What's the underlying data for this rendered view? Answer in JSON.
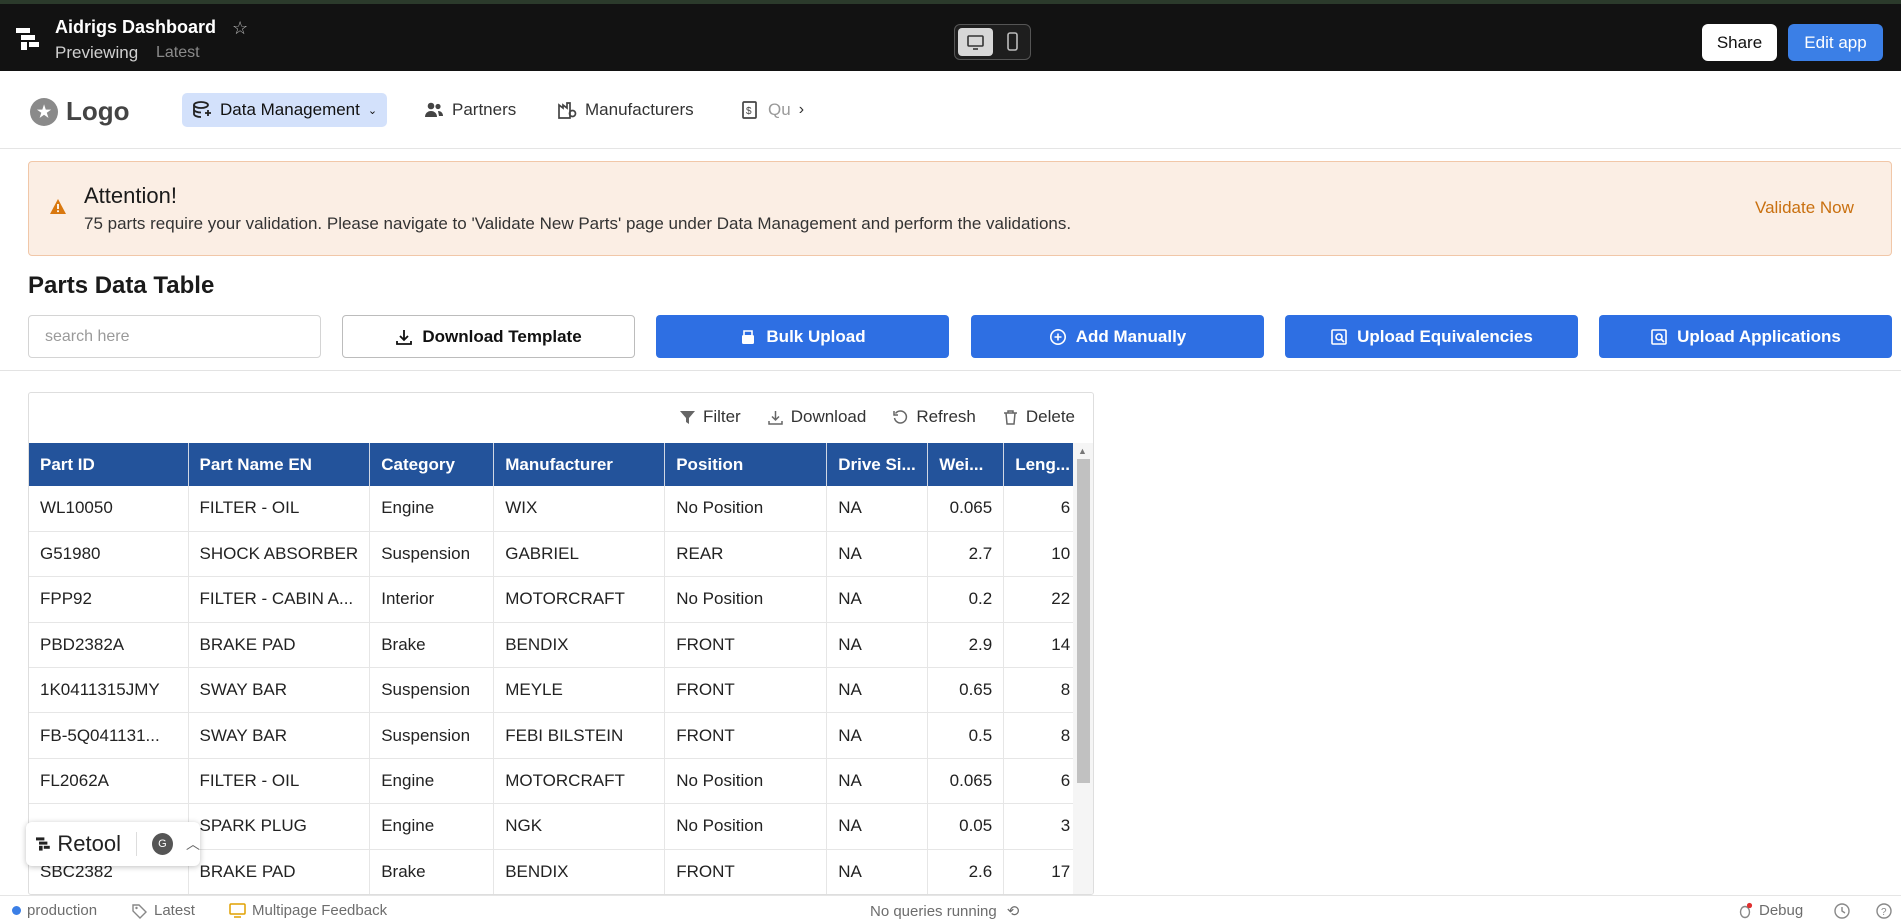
{
  "topbar": {
    "app_title": "Aidrigs Dashboard",
    "mode": "Previewing",
    "version": "Latest",
    "share_label": "Share",
    "edit_label": "Edit app"
  },
  "nav": {
    "logo_text": "Logo",
    "items": [
      {
        "label": "Data Management",
        "icon": "database-icon"
      },
      {
        "label": "Partners",
        "icon": "people-icon"
      },
      {
        "label": "Manufacturers",
        "icon": "factory-icon"
      },
      {
        "label": "Qu",
        "icon": "quote-icon"
      }
    ]
  },
  "alert": {
    "title": "Attention!",
    "message": "75 parts require your validation. Please navigate to 'Validate New Parts' page under Data Management and perform the validations.",
    "action": "Validate Now"
  },
  "section": {
    "title": "Parts Data Table",
    "search_placeholder": "search here",
    "buttons": {
      "download_template": "Download Template",
      "bulk_upload": "Bulk Upload",
      "add_manually": "Add Manually",
      "upload_equivalencies": "Upload Equivalencies",
      "upload_applications": "Upload Applications"
    }
  },
  "table": {
    "toolbar": {
      "filter": "Filter",
      "download": "Download",
      "refresh": "Refresh",
      "delete": "Delete"
    },
    "columns": [
      "Part ID",
      "Part Name EN",
      "Category",
      "Manufacturer",
      "Position",
      "Drive Si...",
      "Wei...",
      "Leng..."
    ],
    "rows": [
      [
        "WL10050",
        "FILTER - OIL",
        "Engine",
        "WIX",
        "No Position",
        "NA",
        "0.065",
        "6"
      ],
      [
        "G51980",
        "SHOCK ABSORBER",
        "Suspension",
        "GABRIEL",
        "REAR",
        "NA",
        "2.7",
        "10"
      ],
      [
        "FPP92",
        "FILTER - CABIN A...",
        "Interior",
        "MOTORCRAFT",
        "No Position",
        "NA",
        "0.2",
        "22"
      ],
      [
        "PBD2382A",
        "BRAKE PAD",
        "Brake",
        "BENDIX",
        "FRONT",
        "NA",
        "2.9",
        "14"
      ],
      [
        "1K0411315JMY",
        "SWAY BAR",
        "Suspension",
        "MEYLE",
        "FRONT",
        "NA",
        "0.65",
        "8"
      ],
      [
        "FB-5Q041131...",
        "SWAY BAR",
        "Suspension",
        "FEBI BILSTEIN",
        "FRONT",
        "NA",
        "0.5",
        "8"
      ],
      [
        "FL2062A",
        "FILTER - OIL",
        "Engine",
        "MOTORCRAFT",
        "No Position",
        "NA",
        "0.065",
        "6"
      ],
      [
        "",
        "SPARK PLUG",
        "Engine",
        "NGK",
        "No Position",
        "NA",
        "0.05",
        "3"
      ],
      [
        "SBC2382",
        "BRAKE PAD",
        "Brake",
        "BENDIX",
        "FRONT",
        "NA",
        "2.6",
        "17"
      ]
    ]
  },
  "retool": {
    "brand": "Retool",
    "avatar_initial": "G"
  },
  "footer": {
    "env": "production",
    "tag": "Latest",
    "feedback": "Multipage Feedback",
    "queries": "No queries running",
    "debug": "Debug"
  },
  "colors": {
    "accent": "#2e6fe3",
    "header_blue": "#23539b",
    "alert_bg": "#fbeee4",
    "alert_action": "#c9700f"
  }
}
